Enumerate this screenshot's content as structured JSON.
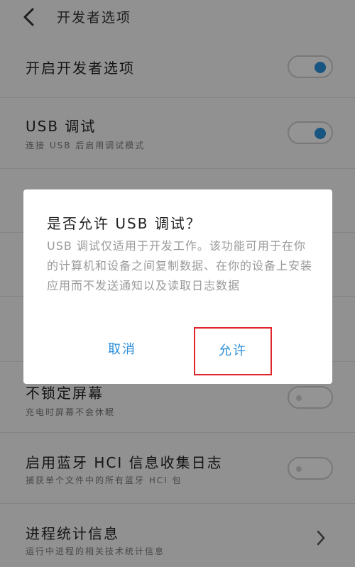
{
  "header": {
    "title": "开发者选项"
  },
  "rows": [
    {
      "title": "开启开发者选项"
    },
    {
      "title": "USB 调试",
      "subtitle": "连接 USB 后启用调试模式"
    },
    {
      "title": "不锁定屏幕",
      "subtitle": "充电时屏幕不会休眠"
    },
    {
      "title": "启用蓝牙 HCI 信息收集日志",
      "subtitle": "捕获单个文件中的所有蓝牙 HCI 包"
    },
    {
      "title": "进程统计信息",
      "subtitle": "运行中进程的相关技术统计信息"
    }
  ],
  "dialog": {
    "title": "是否允许 USB 调试？",
    "message": "USB 调试仅适用于开发工作。该功能可用于在你的计算机和设备之间复制数据、在你的设备上安装应用而不发送通知以及读取日志数据",
    "cancel_label": "取消",
    "allow_label": "允许"
  },
  "toggles": {
    "developer_options": true,
    "usb_debugging": true,
    "stay_awake": false,
    "bluetooth_hci_log": false
  },
  "colors": {
    "accent": "#2b8ed8",
    "highlight_border": "#e0262c"
  },
  "icons": {
    "back": "chevron-left-icon",
    "process_stats": "chevron-right-icon"
  }
}
